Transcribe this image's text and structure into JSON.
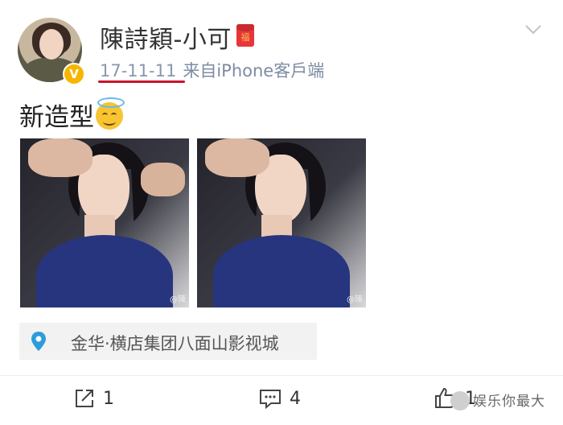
{
  "post": {
    "username": "陳詩穎-小可",
    "date": "17-11-11",
    "source": "来自iPhone客戶端",
    "text": "新造型",
    "photo_watermark_1": "@陳",
    "photo_watermark_2": "@陳",
    "location": "金华·横店集团八面山影视城"
  },
  "badges": {
    "verified": "V",
    "red_badge": "福"
  },
  "actions": {
    "share_count": "1",
    "comment_count": "4",
    "like_count": "1"
  },
  "watermark": {
    "text": "娱乐你最大"
  },
  "icons": [
    "avatar",
    "verified-badge-icon",
    "red-envelope-icon",
    "chevron-down-icon",
    "halo-smile-emoji-icon",
    "location-pin-icon",
    "share-icon",
    "comment-icon",
    "like-icon"
  ],
  "colors": {
    "meta": "#7d8ba3",
    "underline": "#c8132b",
    "verified": "#f6b600"
  }
}
